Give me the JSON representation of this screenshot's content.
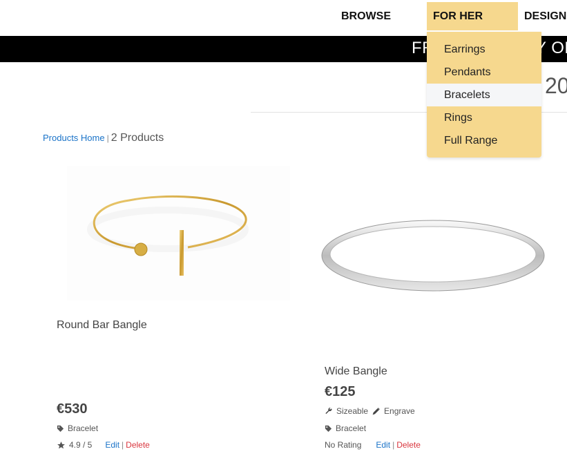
{
  "nav": {
    "browse": "BROWSE",
    "for_her": "FOR HER",
    "design": "DESIGN"
  },
  "banner": {
    "text": "FREE DELIVERY ON ORDERS"
  },
  "heading_partial": "20",
  "breadcrumb": {
    "home": "Products Home",
    "separator": "|",
    "count": "2 Products"
  },
  "dropdown": {
    "items": [
      "Earrings",
      "Pendants",
      "Bracelets",
      "Rings",
      "Full Range"
    ],
    "active": "Bracelets"
  },
  "products": [
    {
      "title": "Round Bar Bangle",
      "price": "€530",
      "category": "Bracelet",
      "rating": "4.9 / 5",
      "edit": "Edit",
      "delete": "Delete",
      "material": "gold"
    },
    {
      "title": "Wide Bangle",
      "price": "€125",
      "features": [
        "Sizeable",
        "Engrave"
      ],
      "category": "Bracelet",
      "rating": "No Rating",
      "edit": "Edit",
      "delete": "Delete",
      "material": "silver"
    }
  ],
  "icons": {
    "tag": "tag-icon",
    "star": "star-icon",
    "wrench": "wrench-icon",
    "pen": "pen-icon"
  },
  "colors": {
    "accent": "#f6d88e",
    "link": "#1a73c8",
    "delete": "#d9363e",
    "banner": "#000000"
  }
}
